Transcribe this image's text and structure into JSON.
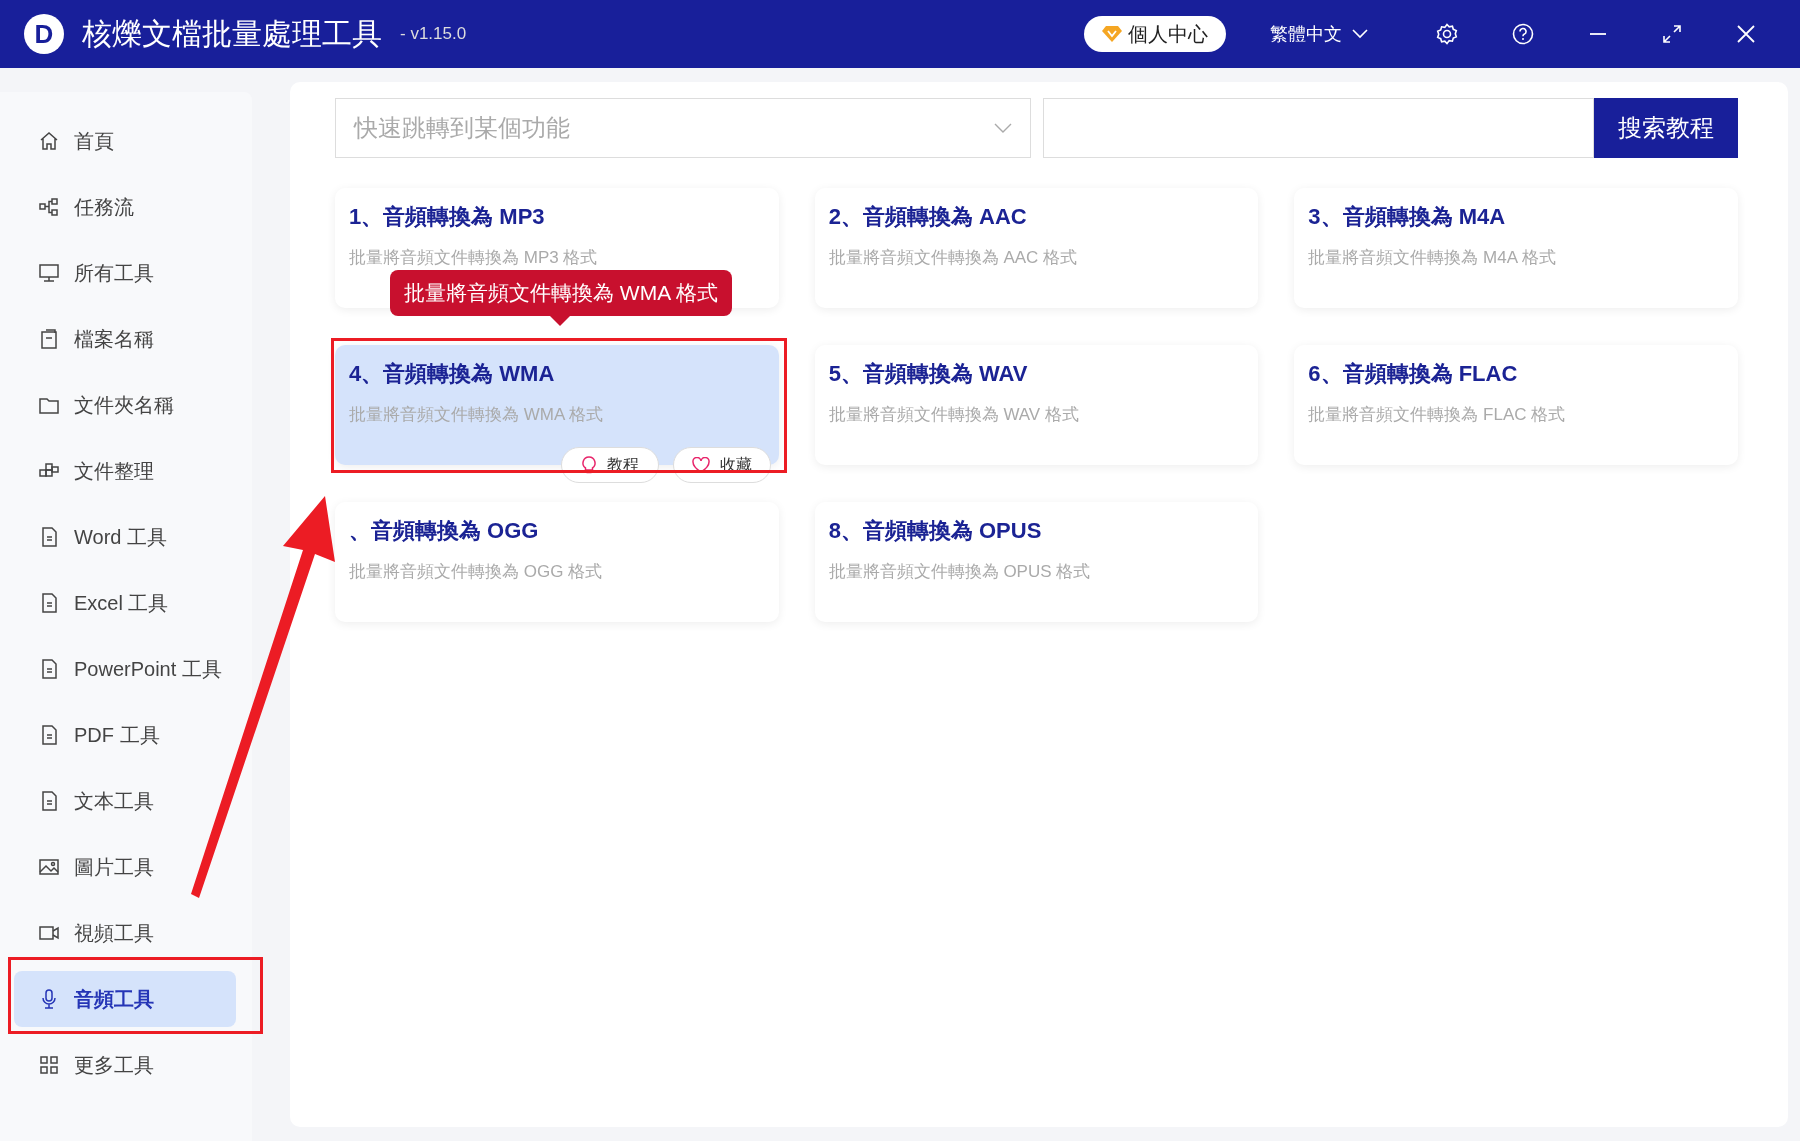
{
  "window": {
    "logo": "D",
    "title": "核爍文檔批量處理工具",
    "version": "- v1.15.0",
    "user_center": "個人中心",
    "language": "繁體中文"
  },
  "sidebar": {
    "items": [
      {
        "label": "首頁",
        "selected": false
      },
      {
        "label": "任務流",
        "selected": false
      },
      {
        "label": "所有工具",
        "selected": false
      },
      {
        "label": "檔案名稱",
        "selected": false
      },
      {
        "label": "文件夾名稱",
        "selected": false
      },
      {
        "label": "文件整理",
        "selected": false
      },
      {
        "label": "Word 工具",
        "selected": false
      },
      {
        "label": "Excel 工具",
        "selected": false
      },
      {
        "label": "PowerPoint 工具",
        "selected": false
      },
      {
        "label": "PDF 工具",
        "selected": false
      },
      {
        "label": "文本工具",
        "selected": false
      },
      {
        "label": "圖片工具",
        "selected": false
      },
      {
        "label": "視頻工具",
        "selected": false
      },
      {
        "label": "音頻工具",
        "selected": true
      },
      {
        "label": "更多工具",
        "selected": false
      }
    ]
  },
  "toolbar": {
    "jump_placeholder": "快速跳轉到某個功能",
    "search_button": "搜索教程"
  },
  "cards": [
    {
      "title": "1、音頻轉換為 MP3",
      "description": "批量將音頻文件轉換為 MP3 格式",
      "selected": false
    },
    {
      "title": "2、音頻轉換為 AAC",
      "description": "批量將音頻文件轉換為 AAC 格式",
      "selected": false
    },
    {
      "title": "3、音頻轉換為 M4A",
      "description": "批量將音頻文件轉換為 M4A 格式",
      "selected": false
    },
    {
      "title": "4、音頻轉換為 WMA",
      "description": "批量將音頻文件轉換為 WMA 格式",
      "selected": true
    },
    {
      "title": "5、音頻轉換為 WAV",
      "description": "批量將音頻文件轉換為 WAV 格式",
      "selected": false
    },
    {
      "title": "6、音頻轉換為 FLAC",
      "description": "批量將音頻文件轉換為 FLAC 格式",
      "selected": false
    },
    {
      "title": "、音頻轉換為 OGG",
      "description": "批量將音頻文件轉換為 OGG 格式",
      "selected": false
    },
    {
      "title": "8、音頻轉換為 OPUS",
      "description": "批量將音頻文件轉換為 OPUS 格式",
      "selected": false
    }
  ],
  "card_actions": [
    "教程",
    "收藏"
  ],
  "tooltip": "批量將音頻文件轉換為 WMA 格式"
}
